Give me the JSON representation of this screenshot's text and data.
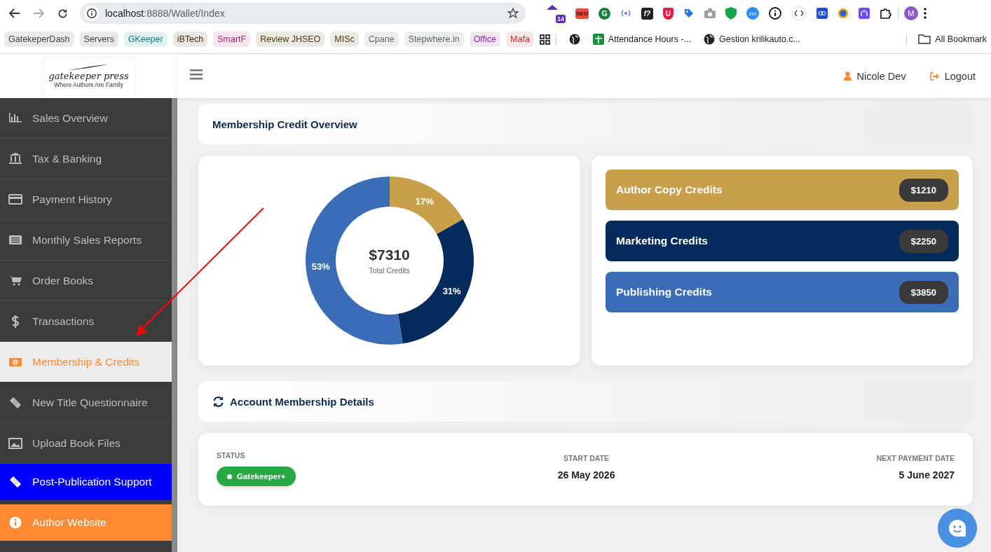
{
  "browser": {
    "url_host": "localhost",
    "url_rest": ":8888/Wallet/Index",
    "extensions": [
      {
        "kind": "house",
        "badge": "14"
      },
      {
        "kind": "label",
        "label": "SEO"
      },
      {
        "kind": "letter",
        "label": "G"
      },
      {
        "kind": "broadcast"
      },
      {
        "kind": "label-dark",
        "label": "f?"
      },
      {
        "kind": "shield-letter",
        "label": "U"
      },
      {
        "kind": "tag"
      },
      {
        "kind": "camera"
      },
      {
        "kind": "shield"
      },
      {
        "kind": "round-label",
        "label": "zm"
      },
      {
        "kind": "info"
      },
      {
        "kind": "code"
      },
      {
        "kind": "link"
      },
      {
        "kind": "gear"
      },
      {
        "kind": "building"
      },
      {
        "kind": "puzzle"
      }
    ],
    "profile_initial": "M",
    "bookmarks": [
      {
        "label": "GatekeperDash",
        "color": "#3c4043"
      },
      {
        "label": "Servers",
        "color": "#3c4043"
      },
      {
        "label": "GKeeper",
        "color": "#0e7c86"
      },
      {
        "label": "iBTech",
        "color": "#3c2a10"
      },
      {
        "label": "SmartF",
        "color": "#c0157a"
      },
      {
        "label": "Review JHSEO",
        "color": "#4a3a08"
      },
      {
        "label": "MISc",
        "color": "#4a3a08"
      },
      {
        "label": "Cpane",
        "color": "#5f6368"
      },
      {
        "label": "Stepwhere.in",
        "color": "#5f6368"
      },
      {
        "label": "Office",
        "color": "#8e24aa"
      },
      {
        "label": "Mafa",
        "color": "#c62828"
      }
    ],
    "links": [
      {
        "kind": "globe"
      },
      {
        "kind": "sheet",
        "label": "Attendance Hours -..."
      },
      {
        "kind": "globe",
        "label": "Gestion krilikauto.c..."
      }
    ],
    "all_bookmarks": "All Bookmark"
  },
  "logo": {
    "name": "gatekeeper press",
    "tagline": "Where Authors Are Family"
  },
  "header": {
    "user": "Nicole Dev",
    "logout": "Logout"
  },
  "sidebar": {
    "items": [
      {
        "label": "Sales Overview",
        "kind": "chart",
        "selected": false
      },
      {
        "label": "Tax & Banking",
        "kind": "bank",
        "selected": false
      },
      {
        "label": "Payment History",
        "kind": "card",
        "selected": false
      },
      {
        "label": "Monthly Sales Reports",
        "kind": "list",
        "selected": false
      },
      {
        "label": "Order Books",
        "kind": "cart",
        "selected": false
      },
      {
        "label": "Transactions",
        "kind": "dollar",
        "selected": false
      },
      {
        "label": "Membership & Credits",
        "kind": "money",
        "selected": true
      },
      {
        "label": "New Title Questionnaire",
        "kind": "ticket",
        "selected": false
      },
      {
        "label": "Upload Book Files",
        "kind": "image",
        "selected": false
      },
      {
        "label": "Post-Publication Support",
        "kind": "ticket",
        "selected": false,
        "color": "#0000ff"
      },
      {
        "label": "Author Website",
        "kind": "info",
        "selected": false,
        "color": "#ff8a33"
      }
    ]
  },
  "overview": {
    "title": "Membership Credit Overview",
    "center_value": "$7310",
    "center_label": "Total Credits",
    "chart_data": {
      "type": "donut",
      "values": [
        17,
        31,
        53
      ],
      "value_labels": [
        "17%",
        "31%",
        "53%"
      ]
    },
    "credits": [
      {
        "label": "Author Copy Credits",
        "amount": "$1210",
        "color": "#c8a04c"
      },
      {
        "label": "Marketing Credits",
        "amount": "$2250",
        "color": "#052a5c"
      },
      {
        "label": "Publishing Credits",
        "amount": "$3850",
        "color": "#3b6cb7"
      }
    ]
  },
  "membership": {
    "title": "Account Membership Details",
    "status_label": "STATUS",
    "status": "Gatekeeper+",
    "start_label": "START DATE",
    "start": "26 May 2026",
    "next_label": "NEXT PAYMENT DATE",
    "next": "5 June 2027"
  }
}
